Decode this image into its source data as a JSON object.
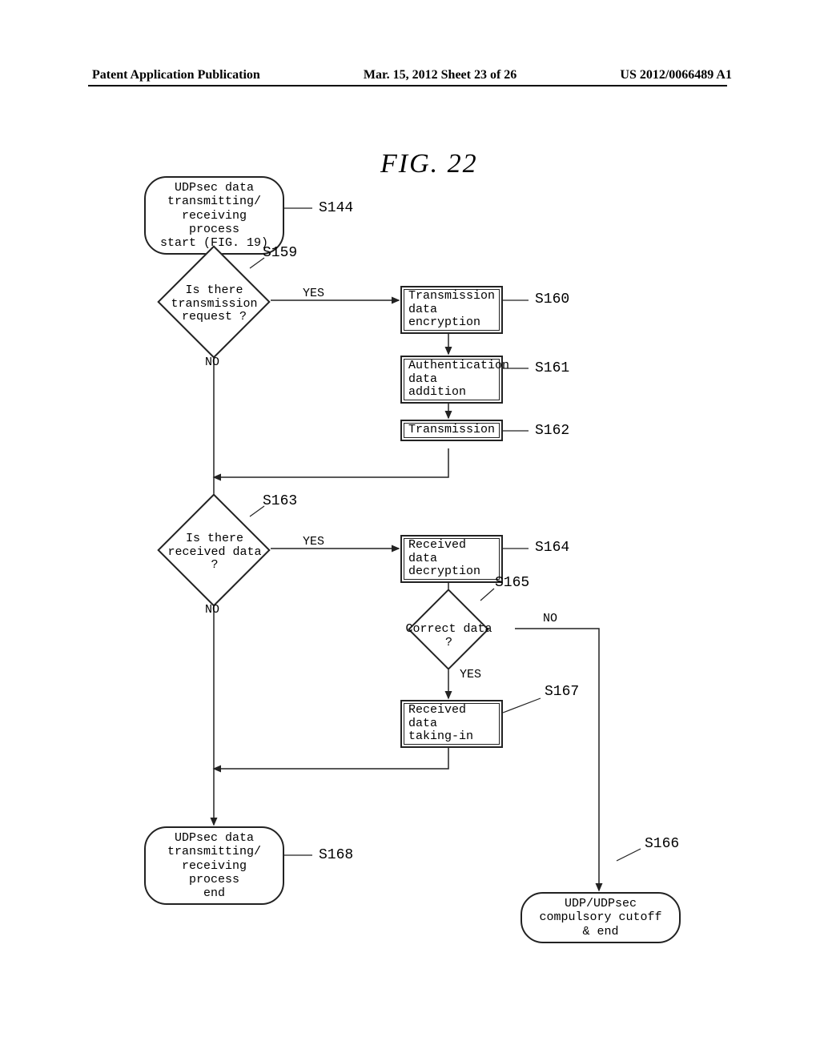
{
  "header": {
    "left": "Patent Application Publication",
    "center": "Mar. 15, 2012  Sheet 23 of 26",
    "right": "US 2012/0066489 A1"
  },
  "figure": {
    "title": "FIG. 22"
  },
  "nodes": {
    "start": "UDPsec data\ntransmitting/\nreceiving process\nstart (FIG. 19)",
    "q_tx": "Is there\ntransmission\nrequest ?",
    "tx_enc": "Transmission\ndata encryption",
    "auth_add": "Authentication\ndata addition",
    "tx": "Transmission",
    "q_rx": "Is there\nreceived data\n?",
    "rx_dec": "Received data\ndecryption",
    "q_correct": "Correct data ?",
    "rx_take": "Received data\ntaking-in",
    "end": "UDPsec data\ntransmitting/\nreceiving process\nend",
    "cutoff": "UDP/UDPsec\ncompulsory cutoff\n& end"
  },
  "labels": {
    "s144": "S144",
    "s159": "S159",
    "s160": "S160",
    "s161": "S161",
    "s162": "S162",
    "s163": "S163",
    "s164": "S164",
    "s165": "S165",
    "s166": "S166",
    "s167": "S167",
    "s168": "S168",
    "yes": "YES",
    "no": "NO",
    "yes2": "YES",
    "no2": "NO",
    "yes3": "YES",
    "no3": "NO"
  }
}
